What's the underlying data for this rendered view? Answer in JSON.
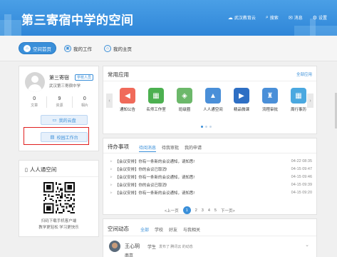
{
  "header": {
    "site_title": "第三寄宿中学的空间",
    "nav": [
      {
        "label": "武汉教育云",
        "icon": "cloud-icon"
      },
      {
        "label": "搜索",
        "icon": "search-icon"
      },
      {
        "label": "消息",
        "icon": "mail-icon"
      },
      {
        "label": "设置",
        "icon": "gear-icon"
      }
    ],
    "colors": {
      "primary": "#3a8fd9",
      "header_bg": "#4a9fe6"
    }
  },
  "tabs": [
    {
      "label": "空间首页",
      "icon": "home-circle-icon",
      "active": true
    },
    {
      "label": "我的工作",
      "icon": "briefcase-icon",
      "active": false
    },
    {
      "label": "我的主页",
      "icon": "house-icon",
      "active": false
    }
  ],
  "profile": {
    "name": "第三寄宿",
    "role": "学校人员",
    "school": "武汉第三寄宿中学",
    "stats": [
      {
        "value": "0",
        "label": "文章"
      },
      {
        "value": "9",
        "label": "资源"
      },
      {
        "value": "0",
        "label": "相片"
      }
    ],
    "cloud_button": "我的云盘",
    "workbench_button": "校园工作台"
  },
  "qr": {
    "title": "人人通空间",
    "caption_line1": "扫码下载手机客户端",
    "caption_line2": "教学更轻松 学习更快乐"
  },
  "apps": {
    "title": "常用应用",
    "more": "全部应用",
    "items": [
      {
        "label": "通知公告",
        "icon": "megaphone-icon",
        "color": "#f06a5a"
      },
      {
        "label": "名师工作室",
        "icon": "teacher-board-icon",
        "color": "#4cb050"
      },
      {
        "label": "班级圈",
        "icon": "class-circle-icon",
        "color": "#6cb86a"
      },
      {
        "label": "人人通空间",
        "icon": "graduation-cap-icon",
        "color": "#4a8fd8"
      },
      {
        "label": "精品微课",
        "icon": "microcourse-icon",
        "color": "#2e6fc4"
      },
      {
        "label": "流程审批",
        "icon": "stamp-icon",
        "color": "#4a8fd8"
      },
      {
        "label": "周行事历",
        "icon": "calendar-icon",
        "color": "#4aa8e0"
      }
    ],
    "page_dots": 3,
    "active_dot": 0
  },
  "todo": {
    "title": "待办事项",
    "tabs": [
      "待阅消息",
      "待我审批",
      "我的申请"
    ],
    "active_tab": 0,
    "items": [
      {
        "text": "【会议安排】你有一条新的会议通知，请知悉!",
        "time": "04-22 08:35"
      },
      {
        "text": "【会议安排】你的会议已取消!",
        "time": "04-15 09:47"
      },
      {
        "text": "【会议安排】你有一条新的会议通知，请知悉!",
        "time": "04-15 09:46"
      },
      {
        "text": "【会议安排】你的会议已取消!",
        "time": "04-15 09:39"
      },
      {
        "text": "【会议安排】你有一条新的会议通知，请知悉!",
        "time": "04-15 09:20"
      }
    ],
    "pager": {
      "prev": "<上一页",
      "pages": [
        "1",
        "2",
        "3",
        "4",
        "5"
      ],
      "active_page": "1",
      "next": "下一页>"
    }
  },
  "space_updates": {
    "title": "空间动态",
    "tabs": [
      "全部",
      "学校",
      "好友",
      "与我相关"
    ],
    "active_tab": 0,
    "post": {
      "user": "王心玥",
      "role": "学生",
      "meta": "发布了 腾讯云 的动态",
      "body": "南京"
    }
  }
}
